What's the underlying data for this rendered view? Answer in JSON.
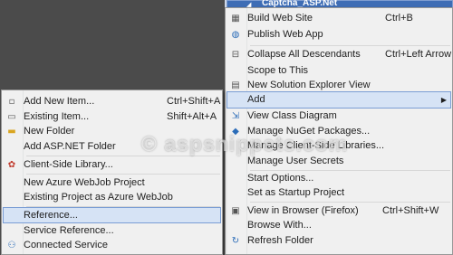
{
  "project": {
    "name": "Captcha_ASP.Net"
  },
  "watermark": "© aspsnippets.com",
  "main_menu": {
    "items": [
      {
        "label": "Build Web Site",
        "shortcut": "Ctrl+B",
        "icon": "build-icon"
      },
      {
        "label": "Publish Web App",
        "shortcut": "",
        "icon": "publish-globe-icon"
      },
      {
        "label": "Collapse All Descendants",
        "shortcut": "Ctrl+Left Arrow",
        "icon": "collapse-icon"
      },
      {
        "label": "Scope to This",
        "shortcut": "",
        "icon": ""
      },
      {
        "label": "New Solution Explorer View",
        "shortcut": "",
        "icon": "new-view-icon"
      },
      {
        "label": "Add",
        "shortcut": "",
        "icon": ""
      },
      {
        "label": "View Class Diagram",
        "shortcut": "",
        "icon": "class-diagram-icon"
      },
      {
        "label": "Manage NuGet Packages...",
        "shortcut": "",
        "icon": "nuget-icon"
      },
      {
        "label": "Manage Client-Side Libraries...",
        "shortcut": "",
        "icon": ""
      },
      {
        "label": "Manage User Secrets",
        "shortcut": "",
        "icon": ""
      },
      {
        "label": "Start Options...",
        "shortcut": "",
        "icon": ""
      },
      {
        "label": "Set as Startup Project",
        "shortcut": "",
        "icon": ""
      },
      {
        "label": "View in Browser (Firefox)",
        "shortcut": "Ctrl+Shift+W",
        "icon": "browser-icon"
      },
      {
        "label": "Browse With...",
        "shortcut": "",
        "icon": ""
      },
      {
        "label": "Refresh Folder",
        "shortcut": "",
        "icon": "refresh-icon"
      }
    ]
  },
  "add_submenu": {
    "items": [
      {
        "label": "Add New Item...",
        "shortcut": "Ctrl+Shift+A",
        "icon": "new-item-icon"
      },
      {
        "label": "Existing Item...",
        "shortcut": "Shift+Alt+A",
        "icon": "existing-item-icon"
      },
      {
        "label": "New Folder",
        "shortcut": "",
        "icon": "folder-icon"
      },
      {
        "label": "Add ASP.NET Folder",
        "shortcut": "",
        "icon": ""
      },
      {
        "label": "Client-Side Library...",
        "shortcut": "",
        "icon": "client-library-icon"
      },
      {
        "label": "New Azure WebJob Project",
        "shortcut": "",
        "icon": ""
      },
      {
        "label": "Existing Project as Azure WebJob",
        "shortcut": "",
        "icon": ""
      },
      {
        "label": "Reference...",
        "shortcut": "",
        "icon": ""
      },
      {
        "label": "Service Reference...",
        "shortcut": "",
        "icon": ""
      },
      {
        "label": "Connected Service",
        "shortcut": "",
        "icon": "connected-service-icon"
      }
    ]
  }
}
